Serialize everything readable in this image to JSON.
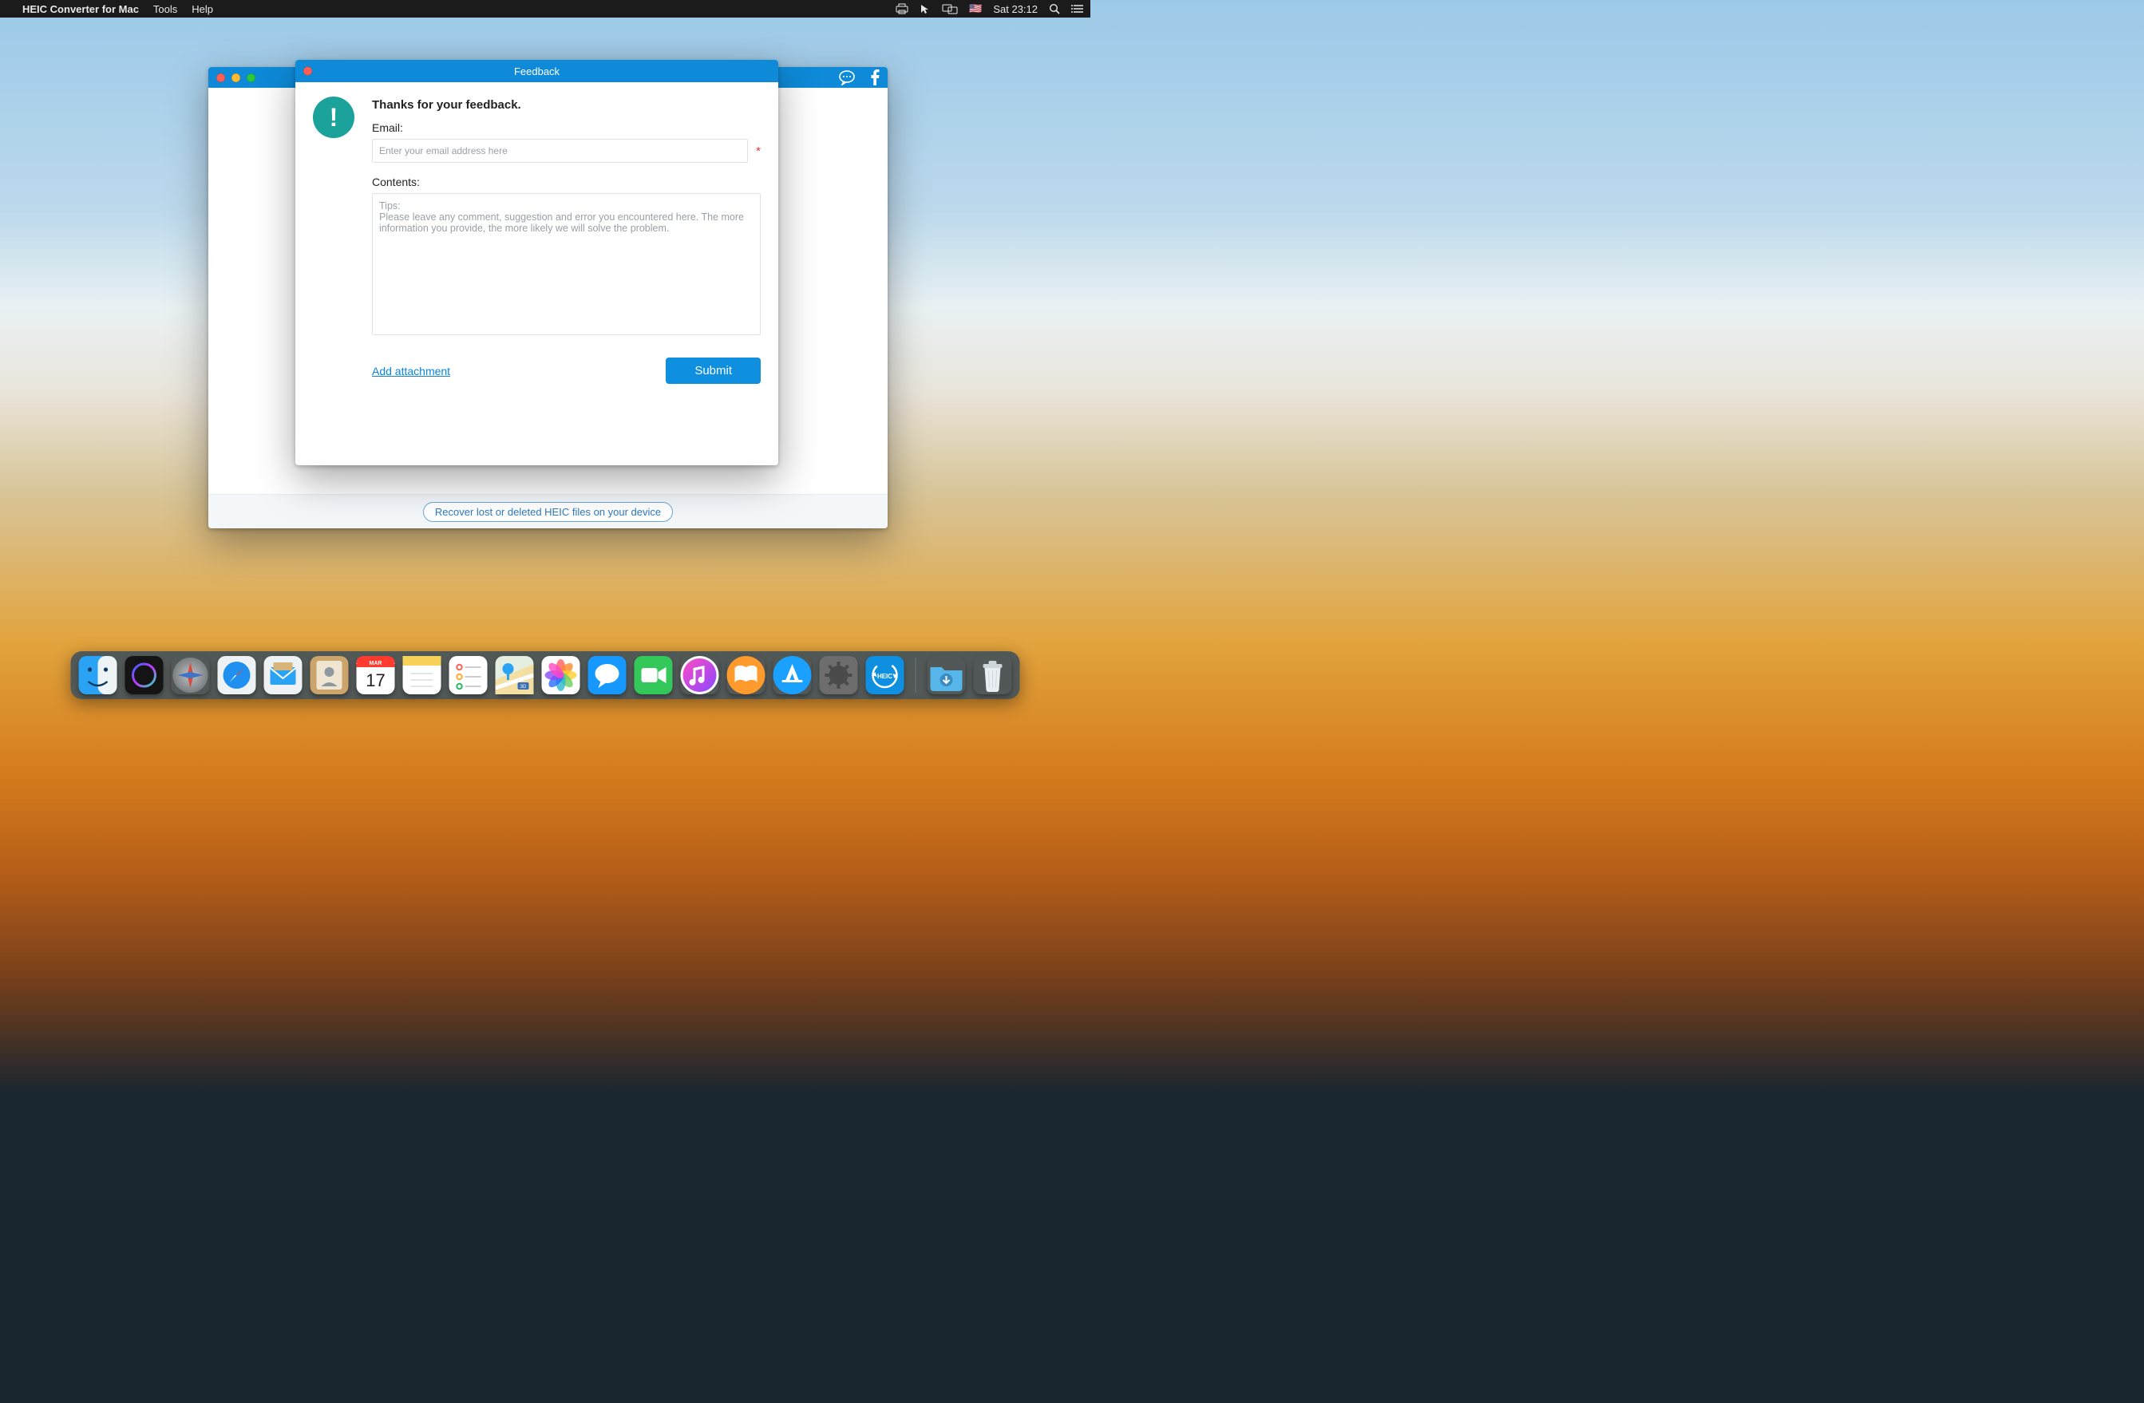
{
  "menubar": {
    "app_name": "HEIC Converter for Mac",
    "items": [
      "Tools",
      "Help"
    ],
    "clock": "Sat 23:12",
    "flag": "🇺🇸"
  },
  "app_window": {
    "toolbar_icons": {
      "chat": "chat-bubble-icon",
      "facebook": "facebook-icon"
    },
    "footer_link": "Recover lost or deleted HEIC files on your device"
  },
  "dialog": {
    "title": "Feedback",
    "heading": "Thanks for your feedback.",
    "email_label": "Email:",
    "email_placeholder": "Enter your email address here",
    "required_mark": "*",
    "contents_label": "Contents:",
    "contents_placeholder": "Tips:\nPlease leave any comment, suggestion and error you encountered here. The more information you provide, the more likely we will solve the problem.",
    "add_attachment": "Add attachment",
    "submit": "Submit"
  },
  "dock": {
    "items": [
      {
        "name": "finder-icon",
        "bg": "#2aa3f5"
      },
      {
        "name": "siri-icon",
        "bg": "#222"
      },
      {
        "name": "launchpad-icon",
        "bg": "#8b8b8b"
      },
      {
        "name": "safari-icon",
        "bg": "#e9eef2"
      },
      {
        "name": "mail-icon",
        "bg": "#e9eef2"
      },
      {
        "name": "contacts-icon",
        "bg": "#caa46a"
      },
      {
        "name": "calendar-icon",
        "bg": "#fff",
        "badge": "17",
        "badge_top": "MAR"
      },
      {
        "name": "notes-icon",
        "bg": "#f6e27a"
      },
      {
        "name": "reminders-icon",
        "bg": "#fff"
      },
      {
        "name": "maps-icon",
        "bg": "#e9eef2"
      },
      {
        "name": "photos-icon",
        "bg": "#fff"
      },
      {
        "name": "messages-icon",
        "bg": "#1798ff"
      },
      {
        "name": "facetime-icon",
        "bg": "#34c85a"
      },
      {
        "name": "itunes-icon",
        "bg": "#fff"
      },
      {
        "name": "ibooks-icon",
        "bg": "#ff9a2d"
      },
      {
        "name": "appstore-icon",
        "bg": "#1aa0ff"
      },
      {
        "name": "preferences-icon",
        "bg": "#6d6d6d"
      },
      {
        "name": "heic-converter-icon",
        "bg": "#0e8fe0"
      }
    ],
    "right_items": [
      {
        "name": "downloads-folder-icon",
        "bg": "#57b6e9"
      },
      {
        "name": "trash-icon",
        "bg": "#e9eef2"
      }
    ]
  }
}
